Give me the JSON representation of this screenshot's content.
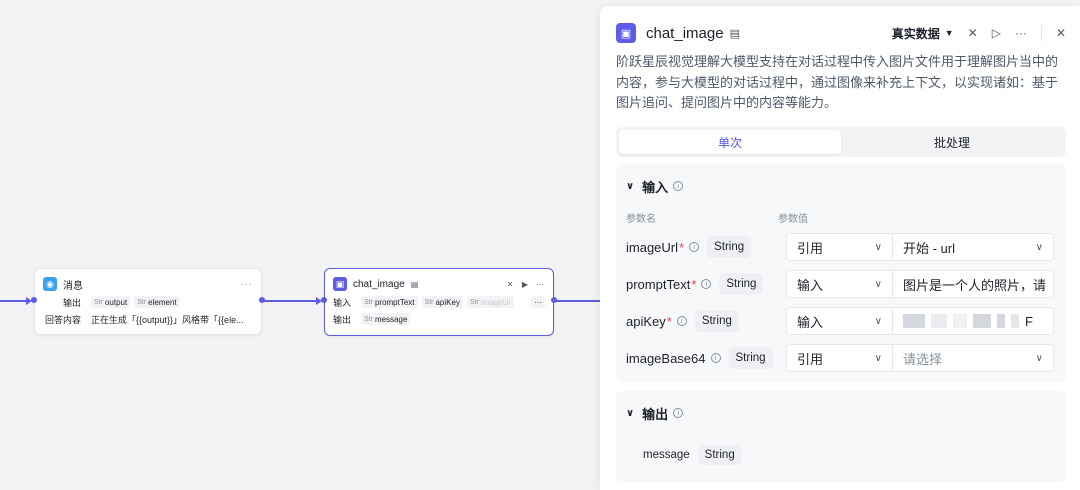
{
  "canvas": {
    "message_node": {
      "title": "消息",
      "rows": [
        {
          "label": "输出",
          "pills": [
            {
              "type": "Str",
              "name": "output"
            },
            {
              "type": "Str",
              "name": "element"
            }
          ]
        },
        {
          "label": "回答内容",
          "value": "正在生成「{{output}}」风格带「{{ele..."
        }
      ]
    },
    "chat_node": {
      "title": "chat_image",
      "rows": [
        {
          "label": "输入",
          "pills": [
            {
              "type": "Str",
              "name": "promptText"
            },
            {
              "type": "Str",
              "name": "apiKey"
            },
            {
              "type": "Str",
              "name": "imageUr"
            }
          ]
        },
        {
          "label": "输出",
          "pills": [
            {
              "type": "Str",
              "name": "message"
            }
          ]
        }
      ],
      "more": "···"
    }
  },
  "panel": {
    "title": "chat_image",
    "mode": "真实数据",
    "description": "阶跃星辰视觉理解大模型支持在对话过程中传入图片文件用于理解图片当中的内容，参与大模型的对话过程中，通过图像来补充上下文，以实现诸如：基于图片追问、提问图片中的内容等能力。",
    "tabs": [
      {
        "label": "单次",
        "active": true
      },
      {
        "label": "批处理",
        "active": false
      }
    ],
    "input_section": {
      "title": "输入",
      "col_name": "参数名",
      "col_value": "参数值",
      "params": [
        {
          "name": "imageUrl",
          "required": true,
          "type": "String",
          "source": "引用",
          "value": "开始 - url"
        },
        {
          "name": "promptText",
          "required": true,
          "type": "String",
          "source": "输入",
          "value": "图片是一个人的照片，请"
        },
        {
          "name": "apiKey",
          "required": true,
          "type": "String",
          "source": "输入",
          "value": "F"
        },
        {
          "name": "imageBase64",
          "required": false,
          "type": "String",
          "source": "引用",
          "placeholder": "请选择"
        }
      ]
    },
    "output_section": {
      "title": "输出",
      "params": [
        {
          "name": "message",
          "type": "String"
        }
      ]
    }
  }
}
